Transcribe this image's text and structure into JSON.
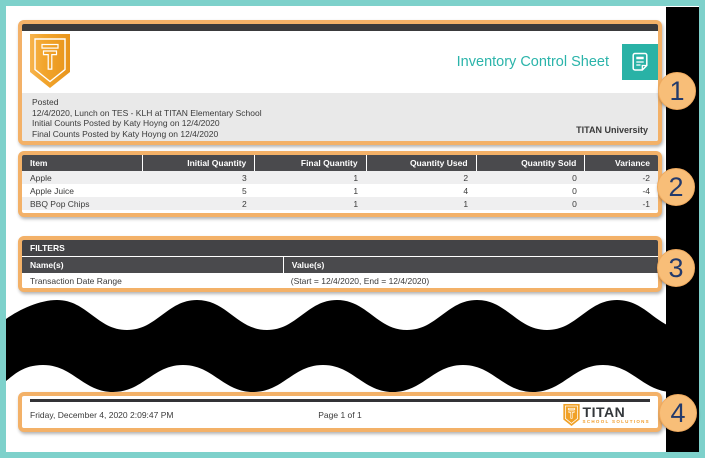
{
  "header": {
    "title": "Inventory Control Sheet",
    "posted": {
      "label": "Posted",
      "event": "12/4/2020, Lunch on TES - KLH at TITAN Elementary School",
      "initial_counts": "Initial Counts Posted by Katy Hoyng on 12/4/2020",
      "final_counts": "Final Counts Posted by Katy Hoyng on 12/4/2020",
      "organization": "TITAN University"
    }
  },
  "inventory_table": {
    "columns": [
      "Item",
      "Initial Quantity",
      "Final Quantity",
      "Quantity Used",
      "Quantity Sold",
      "Variance"
    ],
    "rows": [
      [
        "Apple",
        "3",
        "1",
        "2",
        "0",
        "-2"
      ],
      [
        "Apple Juice",
        "5",
        "1",
        "4",
        "0",
        "-4"
      ],
      [
        "BBQ Pop Chips",
        "2",
        "1",
        "1",
        "0",
        "-1"
      ]
    ]
  },
  "filters": {
    "title": "FILTERS",
    "name_header": "Name(s)",
    "value_header": "Value(s)",
    "rows": [
      {
        "name": "Transaction Date Range",
        "value": "(Start = 12/4/2020, End = 12/4/2020)"
      }
    ]
  },
  "footer": {
    "datetime": "Friday, December 4, 2020 2:09:47 PM",
    "page": "Page 1 of 1",
    "logo_word": "TITAN",
    "logo_subtitle": "SCHOOL SOLUTIONS"
  },
  "callouts": [
    "1",
    "2",
    "3",
    "4"
  ],
  "colors": {
    "frame_teal": "#7ED1CB",
    "accent_teal": "#2BB4AA",
    "annotation_orange": "#F3B168",
    "callout_fill": "#F8BE78",
    "callout_number_navy": "#233A6B",
    "bar_dark": "#3A3A3C",
    "table_header_gray": "#4A4A4D",
    "posted_block_gray": "#E9E9E9",
    "alt_row_gray": "#EFEFF0",
    "logo_orange": "#F0A127"
  }
}
